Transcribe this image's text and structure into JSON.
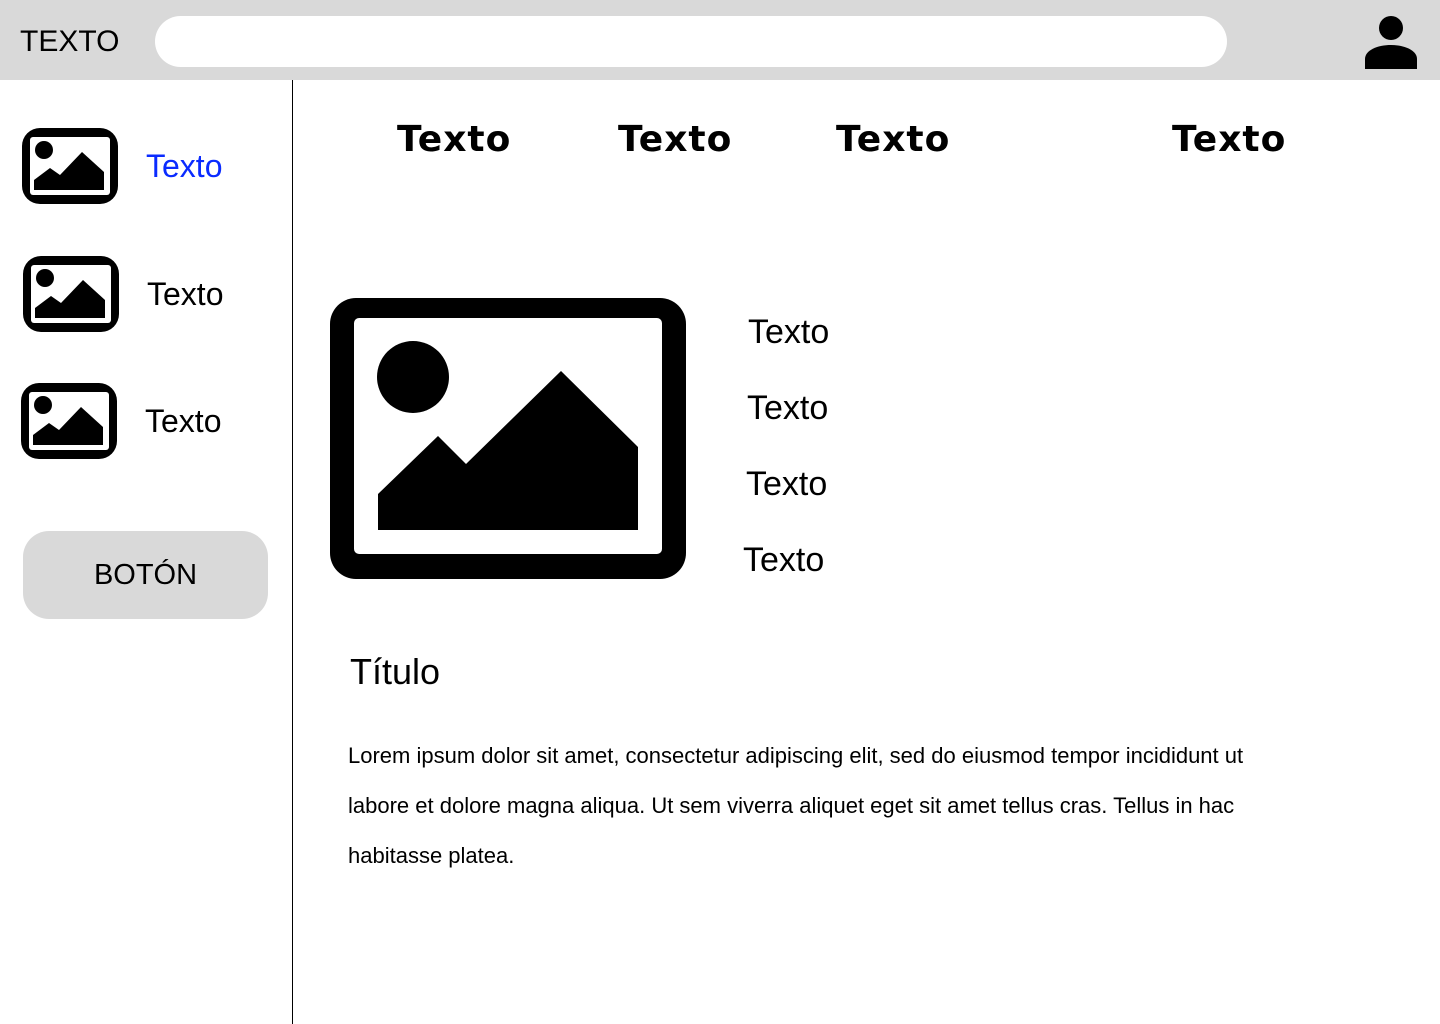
{
  "header": {
    "title": "TEXTO",
    "search_placeholder": "",
    "avatar_icon": "user-avatar-icon"
  },
  "sidebar": {
    "items": [
      {
        "label": "Texto",
        "icon": "image-icon",
        "active": true,
        "color": "#0a2bff"
      },
      {
        "label": "Texto",
        "icon": "image-icon",
        "active": false
      },
      {
        "label": "Texto",
        "icon": "image-icon",
        "active": false
      }
    ],
    "button_label": "BOTÓN"
  },
  "tabs": [
    {
      "label": "Texto"
    },
    {
      "label": "Texto"
    },
    {
      "label": "Texto"
    },
    {
      "label": "Texto"
    }
  ],
  "main": {
    "hero_icon": "image-icon",
    "info_lines": [
      "Texto",
      "Texto",
      "Texto",
      "Texto"
    ],
    "section_title": "Título",
    "body_text": "Lorem ipsum dolor sit amet, consectetur adipiscing elit, sed do eiusmod tempor incididunt ut labore et dolore magna aliqua. Ut sem viverra aliquet eget sit amet tellus cras. Tellus in hac habitasse platea."
  },
  "colors": {
    "header_bg": "#d9d9d9",
    "button_bg": "#d9d9d9",
    "active_link": "#0a2bff"
  }
}
